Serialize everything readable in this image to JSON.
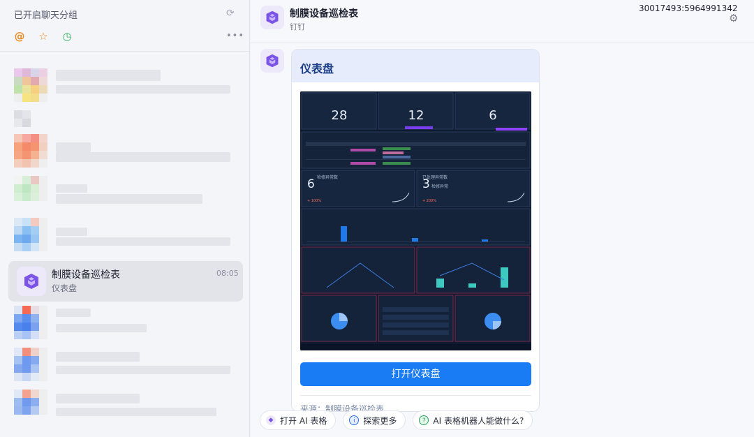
{
  "sidebar": {
    "header": "已开启聊天分组",
    "active_chat": {
      "name": "制膜设备巡检表",
      "preview": "仪表盘",
      "time": "08:05"
    }
  },
  "chat": {
    "title": "制膜设备巡检表",
    "subtitle": "钉钉",
    "session_id": "30017493:5964991342"
  },
  "card": {
    "title": "仪表盘",
    "button": "打开仪表盘",
    "footer": "来源：制膜设备巡检表"
  },
  "dashboard": {
    "kpis": [
      "28",
      "12",
      "6"
    ],
    "big1": "6",
    "big1_label": "检修异常数",
    "big1_pct": "+ 100%",
    "big2": "3",
    "big2_label": "已处理异常数",
    "big2_sub": "检修异常",
    "big2_pct": "+ 200%"
  },
  "chips": [
    "打开 AI 表格",
    "探索更多",
    "AI 表格机器人能做什么?"
  ],
  "colors": {
    "accent": "#1a7cf5",
    "dash_bg": "#0e1a30",
    "brand": "#7b54e6"
  }
}
